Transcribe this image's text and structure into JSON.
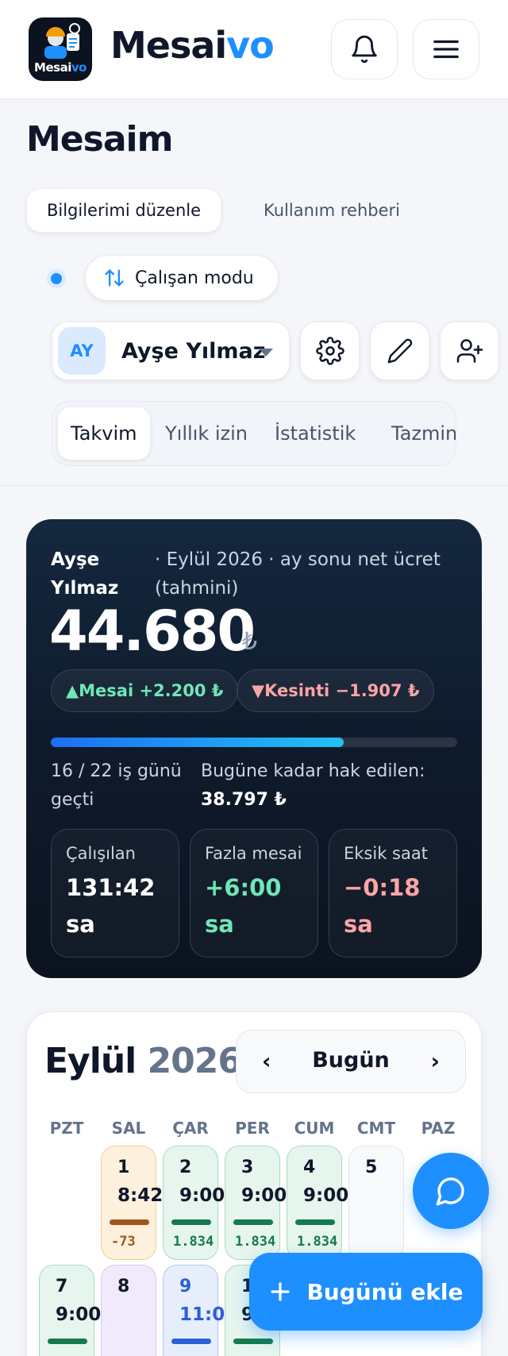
{
  "header": {
    "logo_text_a": "Mesai",
    "logo_text_b": "vo",
    "brand_a": "Mesai",
    "brand_b": "vo",
    "bell_icon": "bell-icon",
    "menu_icon": "hamburger-menu-icon"
  },
  "page": {
    "title": "Mesaim",
    "edit_info_label": "Bilgilerimi düzenle",
    "guide_label": "Kullanım rehberi",
    "mode_label": "Çalışan modu"
  },
  "user": {
    "initials": "AY",
    "name": "Ayşe Yılmaz"
  },
  "tabs": [
    {
      "label": "Takvim",
      "active": true
    },
    {
      "label": "Yıllık izin",
      "active": false
    },
    {
      "label": "İstatistik",
      "active": false
    },
    {
      "label": "Tazmin",
      "active": false
    }
  ],
  "salary": {
    "name": "Ayşe Yılmaz",
    "subtitle": "· Eylül 2026 · ay sonu net ücret (tahmini)",
    "amount": "44.680",
    "currency": "₺",
    "overtime_pill": "▲Mesai +2.200 ₺",
    "deduction_pill": "▼Kesinti −1.907 ₺",
    "progress": 0.72,
    "days_text": "16 / 22 iş günü geçti",
    "earned_label": "Bugüne kadar hak edilen:",
    "earned_value": "38.797 ₺",
    "stats": [
      {
        "label": "Çalışılan",
        "value": "131:42 sa",
        "color": "#ffffff"
      },
      {
        "label": "Fazla mesai",
        "value": "+6:00 sa",
        "color": "#6ee7b7"
      },
      {
        "label": "Eksik saat",
        "value": "−0:18 sa",
        "color": "#fca5a5"
      }
    ]
  },
  "calendar": {
    "month": "Eylül",
    "year": "2026",
    "prev": "‹",
    "next": "›",
    "today_label": "Bugün",
    "weekdays": [
      "PZT",
      "SAL",
      "ÇAR",
      "PER",
      "CUM",
      "CMT",
      "PAZ"
    ],
    "days": [
      {
        "num": "1",
        "hours": "8:42",
        "sub": "-73",
        "style": "orange",
        "bar": "#a0561a",
        "sub_color": "#a0561a"
      },
      {
        "num": "2",
        "hours": "9:00",
        "sub": "1.834",
        "style": "green",
        "bar": "#157a4d",
        "sub_color": "#157a4d"
      },
      {
        "num": "3",
        "hours": "9:00",
        "sub": "1.834",
        "style": "green",
        "bar": "#157a4d",
        "sub_color": "#157a4d"
      },
      {
        "num": "4",
        "hours": "9:00",
        "sub": "1.834",
        "style": "green",
        "bar": "#157a4d",
        "sub_color": "#157a4d"
      },
      {
        "num": "5",
        "hours": "",
        "sub": "",
        "style": "gray",
        "bar": "",
        "sub_color": ""
      },
      {
        "num": "7",
        "hours": "9:00",
        "sub": "",
        "style": "green",
        "bar": "#157a4d",
        "sub_color": ""
      },
      {
        "num": "8",
        "hours": "",
        "sub": "",
        "style": "purple",
        "bar": "",
        "sub_color": ""
      },
      {
        "num": "9",
        "hours": "11:00",
        "sub": "",
        "style": "blue",
        "bar": "#2c5fd6",
        "sub_color": "",
        "num_color": "#2c5fd6"
      },
      {
        "num": "10",
        "hours": "9:00",
        "sub": "",
        "style": "green",
        "bar": "#157a4d",
        "sub_color": ""
      }
    ]
  },
  "fab": {
    "chat_icon": "chat-bubble-icon",
    "add_today_label": "Bugünü ekle"
  },
  "colors": {
    "accent": "#1e8fff",
    "dark_card": "#0f1b2c"
  }
}
